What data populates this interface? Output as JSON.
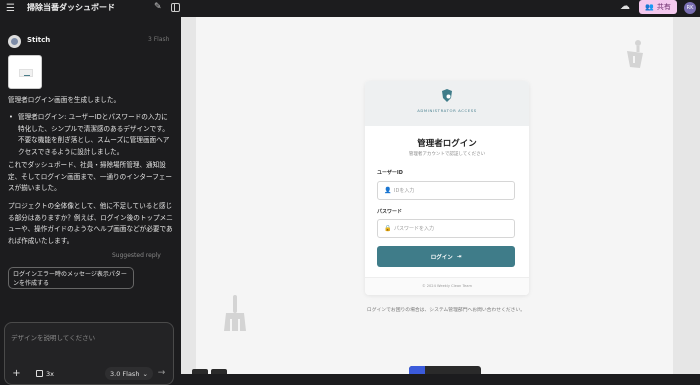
{
  "topbar": {
    "title": "掃除当番ダッシュボード",
    "share_label": "共有",
    "avatar_initials": "RK",
    "icons": [
      "menu-icon",
      "edit-icon",
      "sidebar-toggle-icon",
      "cloud-icon",
      "people-icon"
    ]
  },
  "chat": {
    "agent_name": "Stitch",
    "agent_badge": "3 Flash",
    "message_intro": "管理者ログイン画面を生成しました。",
    "bullets": [
      "管理者ログイン: ユーザーIDとパスワードの入力に特化した、シンプルで清潔感のあるデザインです。不要な機能を削ぎ落とし、スムーズに管理画面へアクセスできるように設計しました。"
    ],
    "message_2": "これでダッシュボード、社員・掃除場所管理、通知設定、そしてログイン画面まで、一通りのインターフェースが揃いました。",
    "message_3": "プロジェクトの全体像として、他に不足していると感じる部分はありますか？例えば、ログイン後のトップメニューや、操作ガイドのようなヘルプ画面などが必要であれば作成いたします。",
    "suggested_label": "Suggested reply",
    "suggestion_chip": "ログインエラー時のメッセージ表示パターンを作成する",
    "prompt_placeholder": "デザインを説明してください",
    "multiplier_label": "3x",
    "model_label": "3.0 Flash"
  },
  "card": {
    "header_caption": "ADMINISTRATOR ACCESS",
    "title": "管理者ログイン",
    "subtitle": "管理者アカウントで認証してください",
    "user_label": "ユーザーID",
    "user_placeholder": "IDを入力",
    "password_label": "パスワード",
    "password_placeholder": "パスワードを入力",
    "login_button": "ログイン",
    "footer": "© 2024 Weekly Clean Team"
  },
  "help_text": "ログインでお困りの場合は、システム管理部門へお問い合わせください。",
  "colors": {
    "accent": "#3f7c89",
    "share_bg": "#f4c9ee",
    "panel_bg": "#1c1c1e",
    "avatar": "#7a6fb3"
  }
}
